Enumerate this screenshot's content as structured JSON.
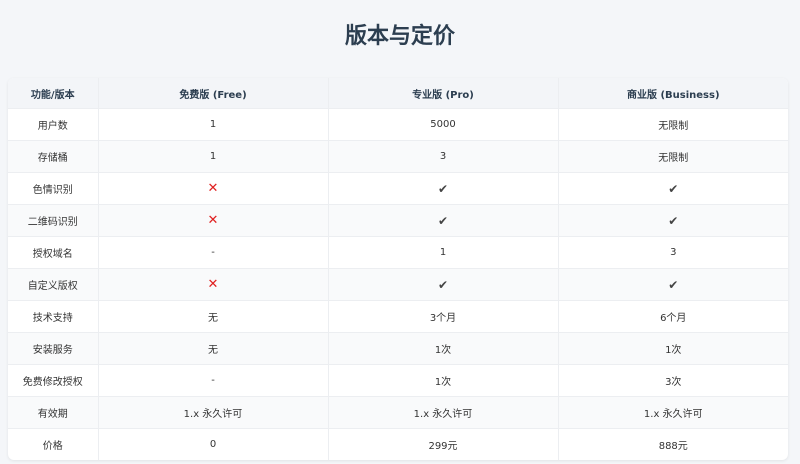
{
  "page": {
    "title": "版本与定价"
  },
  "colors": {
    "cross": "#e02020",
    "header_bg": "#f3f5f8",
    "title": "#2c3e50"
  },
  "table": {
    "headers": [
      "功能/版本",
      "免费版 (Free)",
      "专业版 (Pro)",
      "商业版 (Business)"
    ],
    "rows": [
      {
        "feature": "用户数",
        "cells": [
          "1",
          "5000",
          "无限制"
        ]
      },
      {
        "feature": "存储桶",
        "cells": [
          "1",
          "3",
          "无限制"
        ]
      },
      {
        "feature": "色情识别",
        "cells": [
          "✕",
          "✔",
          "✔"
        ]
      },
      {
        "feature": "二维码识别",
        "cells": [
          "✕",
          "✔",
          "✔"
        ]
      },
      {
        "feature": "授权域名",
        "cells": [
          "-",
          "1",
          "3"
        ]
      },
      {
        "feature": "自定义版权",
        "cells": [
          "✕",
          "✔",
          "✔"
        ]
      },
      {
        "feature": "技术支持",
        "cells": [
          "无",
          "3个月",
          "6个月"
        ]
      },
      {
        "feature": "安装服务",
        "cells": [
          "无",
          "1次",
          "1次"
        ]
      },
      {
        "feature": "免费修改授权",
        "cells": [
          "-",
          "1次",
          "3次"
        ]
      },
      {
        "feature": "有效期",
        "cells": [
          "1.x 永久许可",
          "1.x 永久许可",
          "1.x 永久许可"
        ]
      },
      {
        "feature": "价格",
        "cells": [
          "0",
          "299元",
          "888元"
        ]
      }
    ]
  }
}
